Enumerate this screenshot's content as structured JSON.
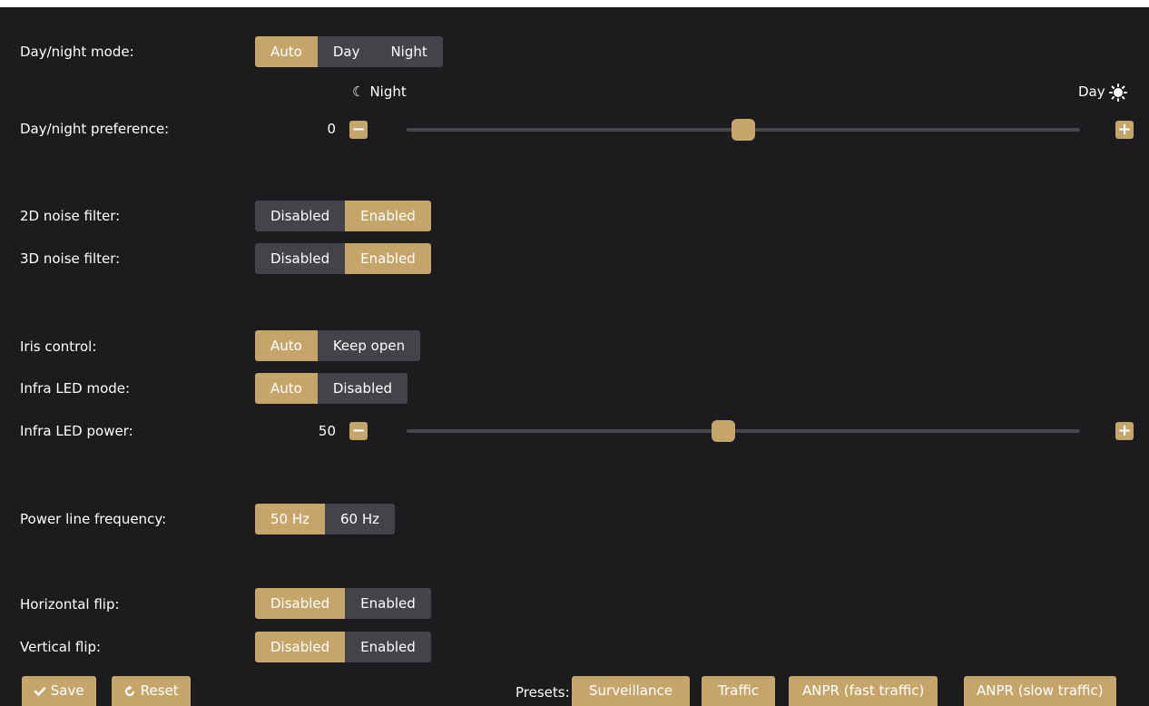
{
  "rows": {
    "day_night_mode": {
      "label": "Day/night mode:",
      "options": [
        "Auto",
        "Day",
        "Night"
      ],
      "selected": "Auto"
    },
    "day_night_preference": {
      "label": "Day/night preference:",
      "value": "0",
      "slider_value": 0.5,
      "scale_left": "Night",
      "scale_right": "Day"
    },
    "noise_2d": {
      "label": "2D noise filter:",
      "options": [
        "Disabled",
        "Enabled"
      ],
      "selected": "Enabled"
    },
    "noise_3d": {
      "label": "3D noise filter:",
      "options": [
        "Disabled",
        "Enabled"
      ],
      "selected": "Enabled"
    },
    "iris_control": {
      "label": "Iris control:",
      "options": [
        "Auto",
        "Keep open"
      ],
      "selected": "Auto"
    },
    "infra_led_mode": {
      "label": "Infra LED mode:",
      "options": [
        "Auto",
        "Disabled"
      ],
      "selected": "Auto"
    },
    "infra_led_power": {
      "label": "Infra LED power:",
      "value": "50",
      "slider_value": 0.47
    },
    "power_line_frequency": {
      "label": "Power line frequency:",
      "options": [
        "50 Hz",
        "60 Hz"
      ],
      "selected": "50 Hz"
    },
    "horizontal_flip": {
      "label": "Horizontal flip:",
      "options": [
        "Disabled",
        "Enabled"
      ],
      "selected": "Disabled"
    },
    "vertical_flip": {
      "label": "Vertical flip:",
      "options": [
        "Disabled",
        "Enabled"
      ],
      "selected": "Disabled"
    }
  },
  "footer": {
    "save_label": "Save",
    "reset_label": "Reset",
    "presets_label": "Presets:",
    "presets": [
      "Surveillance",
      "Traffic",
      "ANPR (fast traffic)",
      "ANPR (slow traffic)"
    ]
  },
  "colors": {
    "background": "#1c1c1f",
    "accent": "#c6a56a",
    "button": "#424448",
    "track": "#45474b"
  },
  "icons": {
    "save": "check-icon",
    "reset": "refresh-icon",
    "night": "moon-icon",
    "day": "sun-icon",
    "minus": "minus-icon",
    "plus": "plus-icon"
  }
}
